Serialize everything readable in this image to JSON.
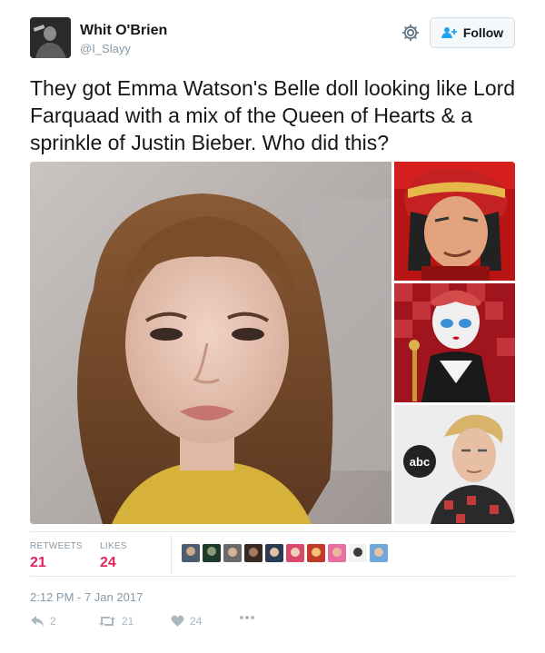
{
  "user": {
    "name": "Whit O'Brien",
    "handle": "@I_Slayy"
  },
  "header": {
    "follow_label": "Follow",
    "gear_icon": "gear-icon",
    "follow_icon": "add-user-icon"
  },
  "tweet": {
    "text": "They got Emma Watson's Belle doll looking like Lord Farquaad with a mix of the Queen of Hearts & a sprinkle of Justin Bieber. Who did this?"
  },
  "media": {
    "side_logo_text": "abc"
  },
  "stats": {
    "retweets_label": "RETWEETS",
    "retweets_count": "21",
    "likes_label": "LIKES",
    "likes_count": "24",
    "accent_color": "#e0245e"
  },
  "timestamp": "2:12 PM - 7 Jan 2017",
  "actions": {
    "reply_count": "2",
    "retweet_count": "21",
    "like_count": "24"
  }
}
